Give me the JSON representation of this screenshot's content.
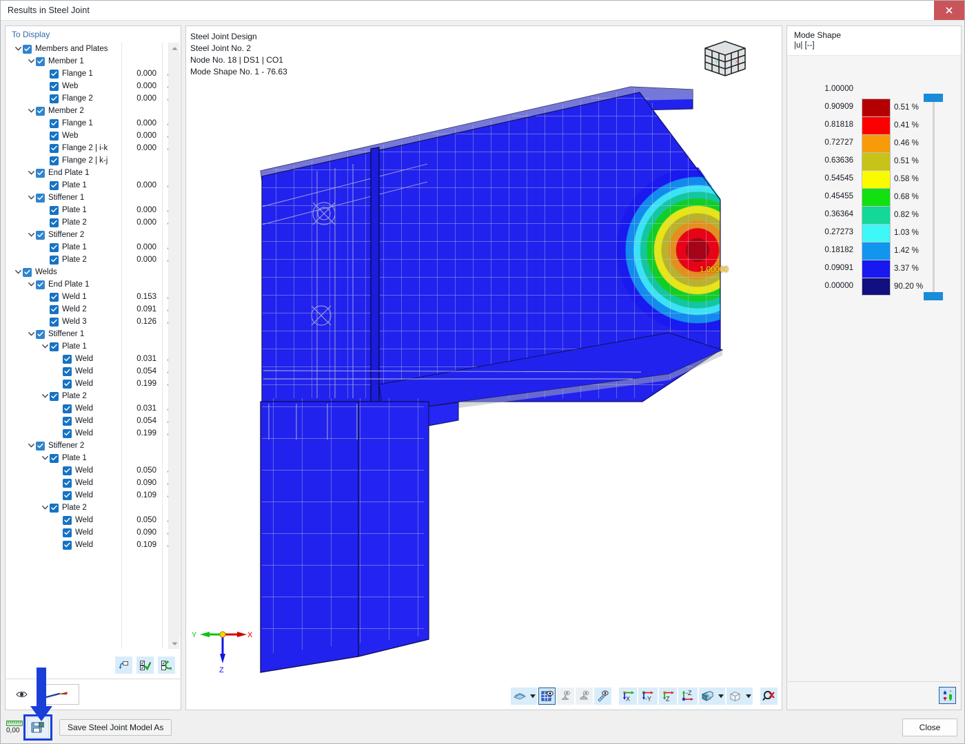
{
  "window": {
    "title": "Results in Steel Joint",
    "close_glyph": "✖"
  },
  "left_panel": {
    "header": "To Display",
    "tree": [
      {
        "indent": 0,
        "twisty": "down",
        "checked": true,
        "label": "Members and Plates",
        "value": "",
        "ok": false
      },
      {
        "indent": 1,
        "twisty": "down",
        "checked": true,
        "label": "Member 1",
        "value": "",
        "ok": false
      },
      {
        "indent": 2,
        "twisty": "none",
        "checked": true,
        "label": "Flange 1",
        "value": "0.000",
        "ok": true
      },
      {
        "indent": 2,
        "twisty": "none",
        "checked": true,
        "label": "Web",
        "value": "0.000",
        "ok": true
      },
      {
        "indent": 2,
        "twisty": "none",
        "checked": true,
        "label": "Flange 2",
        "value": "0.000",
        "ok": true
      },
      {
        "indent": 1,
        "twisty": "down",
        "checked": true,
        "label": "Member 2",
        "value": "",
        "ok": false
      },
      {
        "indent": 2,
        "twisty": "none",
        "checked": true,
        "label": "Flange 1",
        "value": "0.000",
        "ok": true
      },
      {
        "indent": 2,
        "twisty": "none",
        "checked": true,
        "label": "Web",
        "value": "0.000",
        "ok": true
      },
      {
        "indent": 2,
        "twisty": "none",
        "checked": true,
        "label": "Flange 2 | i-k",
        "value": "0.000",
        "ok": true
      },
      {
        "indent": 2,
        "twisty": "none",
        "checked": true,
        "label": "Flange 2 | k-j",
        "value": "",
        "ok": false
      },
      {
        "indent": 1,
        "twisty": "down",
        "checked": true,
        "label": "End Plate 1",
        "value": "",
        "ok": false
      },
      {
        "indent": 2,
        "twisty": "none",
        "checked": true,
        "label": "Plate 1",
        "value": "0.000",
        "ok": true
      },
      {
        "indent": 1,
        "twisty": "down",
        "checked": true,
        "label": "Stiffener 1",
        "value": "",
        "ok": false
      },
      {
        "indent": 2,
        "twisty": "none",
        "checked": true,
        "label": "Plate 1",
        "value": "0.000",
        "ok": true
      },
      {
        "indent": 2,
        "twisty": "none",
        "checked": true,
        "label": "Plate 2",
        "value": "0.000",
        "ok": true
      },
      {
        "indent": 1,
        "twisty": "down",
        "checked": true,
        "label": "Stiffener 2",
        "value": "",
        "ok": false
      },
      {
        "indent": 2,
        "twisty": "none",
        "checked": true,
        "label": "Plate 1",
        "value": "0.000",
        "ok": true
      },
      {
        "indent": 2,
        "twisty": "none",
        "checked": true,
        "label": "Plate 2",
        "value": "0.000",
        "ok": true
      },
      {
        "indent": 0,
        "twisty": "down",
        "checked": true,
        "label": "Welds",
        "value": "",
        "ok": false
      },
      {
        "indent": 1,
        "twisty": "down",
        "checked": true,
        "label": "End Plate 1",
        "value": "",
        "ok": false
      },
      {
        "indent": 2,
        "twisty": "none",
        "checked": true,
        "label": "Weld 1",
        "value": "0.153",
        "ok": true
      },
      {
        "indent": 2,
        "twisty": "none",
        "checked": true,
        "label": "Weld 2",
        "value": "0.091",
        "ok": true
      },
      {
        "indent": 2,
        "twisty": "none",
        "checked": true,
        "label": "Weld 3",
        "value": "0.126",
        "ok": true
      },
      {
        "indent": 1,
        "twisty": "down",
        "checked": true,
        "label": "Stiffener 1",
        "value": "",
        "ok": false
      },
      {
        "indent": 2,
        "twisty": "down",
        "checked": true,
        "label": "Plate 1",
        "value": "",
        "ok": false
      },
      {
        "indent": 3,
        "twisty": "none",
        "checked": true,
        "label": "Weld",
        "value": "0.031",
        "ok": true
      },
      {
        "indent": 3,
        "twisty": "none",
        "checked": true,
        "label": "Weld",
        "value": "0.054",
        "ok": true
      },
      {
        "indent": 3,
        "twisty": "none",
        "checked": true,
        "label": "Weld",
        "value": "0.199",
        "ok": true
      },
      {
        "indent": 2,
        "twisty": "down",
        "checked": true,
        "label": "Plate 2",
        "value": "",
        "ok": false
      },
      {
        "indent": 3,
        "twisty": "none",
        "checked": true,
        "label": "Weld",
        "value": "0.031",
        "ok": true
      },
      {
        "indent": 3,
        "twisty": "none",
        "checked": true,
        "label": "Weld",
        "value": "0.054",
        "ok": true
      },
      {
        "indent": 3,
        "twisty": "none",
        "checked": true,
        "label": "Weld",
        "value": "0.199",
        "ok": true
      },
      {
        "indent": 1,
        "twisty": "down",
        "checked": true,
        "label": "Stiffener 2",
        "value": "",
        "ok": false
      },
      {
        "indent": 2,
        "twisty": "down",
        "checked": true,
        "label": "Plate 1",
        "value": "",
        "ok": false
      },
      {
        "indent": 3,
        "twisty": "none",
        "checked": true,
        "label": "Weld",
        "value": "0.050",
        "ok": true
      },
      {
        "indent": 3,
        "twisty": "none",
        "checked": true,
        "label": "Weld",
        "value": "0.090",
        "ok": true
      },
      {
        "indent": 3,
        "twisty": "none",
        "checked": true,
        "label": "Weld",
        "value": "0.109",
        "ok": true
      },
      {
        "indent": 2,
        "twisty": "down",
        "checked": true,
        "label": "Plate 2",
        "value": "",
        "ok": false
      },
      {
        "indent": 3,
        "twisty": "none",
        "checked": true,
        "label": "Weld",
        "value": "0.050",
        "ok": true
      },
      {
        "indent": 3,
        "twisty": "none",
        "checked": true,
        "label": "Weld",
        "value": "0.090",
        "ok": true
      },
      {
        "indent": 3,
        "twisty": "none",
        "checked": true,
        "label": "Weld",
        "value": "0.109",
        "ok": true
      }
    ],
    "buttons": [
      {
        "name": "reset-view-button",
        "icon": "rotate-arrow-icon"
      },
      {
        "name": "select-all-button",
        "icon": "checkbox-check-icon"
      },
      {
        "name": "invert-selection-button",
        "icon": "checkbox-swap-icon"
      }
    ],
    "preview": {
      "eye_icon": "eye-icon",
      "swatch_icon": "weld-symbol-icon"
    },
    "ok_glyph": "✓"
  },
  "viewport": {
    "caption_lines": [
      "Steel Joint Design",
      "Steel Joint No. 2",
      "Node No. 18 | DS1 | CO1",
      "Mode Shape No. 1 - 76.63"
    ],
    "center_value_label": "1.00000",
    "axes": {
      "x": "X",
      "y": "Y",
      "z": "Z"
    },
    "viewcube_faces": {
      "left": "-Y",
      "right": "-X"
    },
    "toolbar": [
      {
        "name": "rendering-mode-button",
        "icon": "shading-icon",
        "dropdown": true,
        "selected": false
      },
      {
        "name": "show-mesh-button",
        "icon": "mesh-grid-icon",
        "dropdown": false,
        "selected": true
      },
      {
        "name": "show-supports-button",
        "icon": "support-eye-icon",
        "dropdown": false,
        "selected": false,
        "disabled": true
      },
      {
        "name": "show-loads-button",
        "icon": "load-eye-icon",
        "dropdown": false,
        "selected": false,
        "disabled": true
      },
      {
        "name": "show-dimensions-button",
        "icon": "ruler-eye-icon",
        "dropdown": false,
        "selected": false
      },
      {
        "name": "view-in-x-button",
        "icon": "axis-x-icon",
        "dropdown": false,
        "selected": false
      },
      {
        "name": "view-in-minus-y-button",
        "icon": "axis-minus-y-icon",
        "dropdown": false,
        "selected": false
      },
      {
        "name": "view-in-z-button",
        "icon": "axis-z-icon",
        "dropdown": false,
        "selected": false
      },
      {
        "name": "view-in-minus-z-button",
        "icon": "axis-minus-z-icon",
        "dropdown": false,
        "selected": false
      },
      {
        "name": "isometric-view-button",
        "icon": "cube-solid-icon",
        "dropdown": true,
        "selected": false
      },
      {
        "name": "wireframe-view-button",
        "icon": "cube-wire-icon",
        "dropdown": true,
        "selected": false
      },
      {
        "name": "zoom-reset-button",
        "icon": "magnifier-cancel-icon",
        "dropdown": false,
        "selected": false
      }
    ]
  },
  "legend": {
    "title": "Mode Shape",
    "subtitle": "|u| [--]",
    "values": [
      "1.00000",
      "0.90909",
      "0.81818",
      "0.72727",
      "0.63636",
      "0.54545",
      "0.45455",
      "0.36364",
      "0.27273",
      "0.18182",
      "0.09091",
      "0.00000"
    ],
    "bands": [
      {
        "color": "#b40000",
        "percent": "0.51 %"
      },
      {
        "color": "#fc0000",
        "percent": "0.41 %"
      },
      {
        "color": "#f79b08",
        "percent": "0.46 %"
      },
      {
        "color": "#c9c219",
        "percent": "0.51 %"
      },
      {
        "color": "#fbfb00",
        "percent": "0.58 %"
      },
      {
        "color": "#11e011",
        "percent": "0.68 %"
      },
      {
        "color": "#13d898",
        "percent": "0.82 %"
      },
      {
        "color": "#3ef7f7",
        "percent": "1.03 %"
      },
      {
        "color": "#1295ef",
        "percent": "1.42 %"
      },
      {
        "color": "#1818f0",
        "percent": "3.37 %"
      },
      {
        "color": "#101080",
        "percent": "90.20 %"
      }
    ],
    "slider": {
      "top_handle": true,
      "bottom_handle": true,
      "handle_color": "#1a8bd8"
    },
    "bottom_button": {
      "name": "legend-settings-button",
      "icon": "color-scale-icon"
    }
  },
  "bottom_bar": {
    "meter_value": "0,00",
    "save_icon_button": {
      "name": "save-steel-joint-model-button",
      "icon": "save-model-icon"
    },
    "save_as_label": "Save Steel Joint Model As",
    "close_label": "Close"
  },
  "annotation": {
    "arrow_color": "#1a3fd8",
    "highlight_color": "#1a3fd8"
  }
}
